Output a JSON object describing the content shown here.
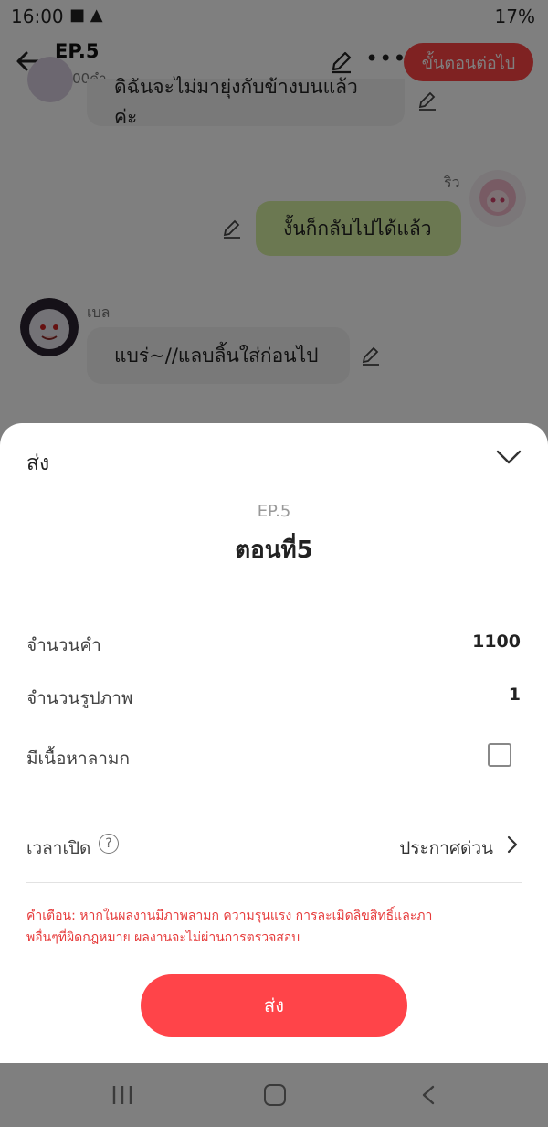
{
  "status_bar": {
    "time": "16:00",
    "battery": "17%"
  },
  "header": {
    "episode": "EP.5",
    "word_count": "1100คำ",
    "next_button": "ขั้นตอนต่อไป"
  },
  "chat": {
    "messages": [
      {
        "sender": "",
        "text": "ดิฉันจะไม่มายุ่งกับข้างบนแล้วค่ะ",
        "side": "left"
      },
      {
        "sender": "ริว",
        "text": "งั้นก็กลับไปได้แล้ว",
        "side": "right"
      },
      {
        "sender": "เบล",
        "text": "แบร่~//แลบลิ้นใส่ก่อนไป",
        "side": "left"
      }
    ]
  },
  "sheet": {
    "title": "ส่ง",
    "episode_label": "EP.5",
    "chapter_title": "ตอนที่5",
    "rows": {
      "word_count_label": "จำนวนคำ",
      "word_count_value": "1100",
      "image_count_label": "จำนวนรูปภาพ",
      "image_count_value": "1",
      "adult_label": "มีเนื้อหาลามก",
      "adult_checked": false,
      "publish_time_label": "เวลาเปิด",
      "publish_time_value": "ประกาศด่วน"
    },
    "warning_line1": "คำเตือน:  หากในผลงานมีภาพลามก  ความรุนแรง  การละเมิดลิขสิทธิ์และภา",
    "warning_line2": "พอื่นๆที่ผิดกฎหมาย ผลงานจะไม่ผ่านการตรวจสอบ",
    "send_button": "ส่ง"
  },
  "colors": {
    "accent": "#ff4449",
    "warning": "#e63b3b",
    "bubble_mine": "#d7f0a2",
    "bubble_other": "#f3f3f3"
  }
}
